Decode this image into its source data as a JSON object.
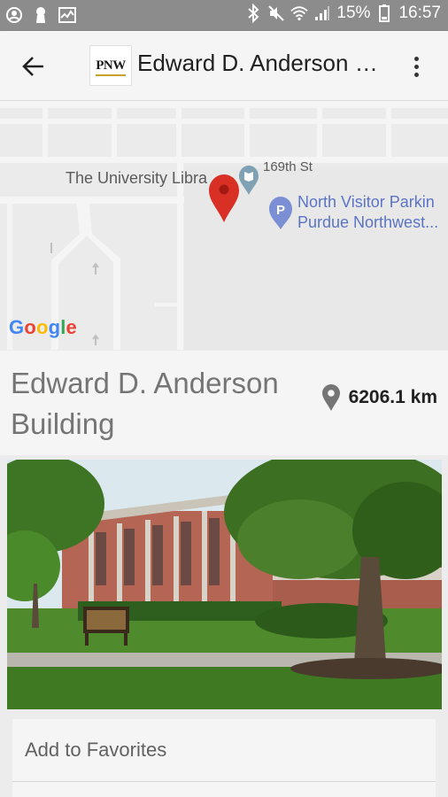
{
  "status_bar": {
    "battery": "15%",
    "time": "16:57",
    "left_icons": [
      "account-circle-icon",
      "keyhole-icon",
      "activity-chart-icon"
    ],
    "right_icons": [
      "bluetooth-icon",
      "mute-icon",
      "wifi-icon",
      "signal-icon",
      "battery-icon"
    ]
  },
  "app_bar": {
    "logo_text": "PNW",
    "title": "Edward D. Anderson Building",
    "back_icon": "arrow-back-icon",
    "menu_icon": "more-vert-icon"
  },
  "map": {
    "labels": {
      "library": "The University Libra",
      "street": "169th St",
      "parking_line1": "North Visitor Parkin",
      "parking_line2": "Purdue Northwest..."
    },
    "google_logo": "Google"
  },
  "building": {
    "name": "Edward D. Anderson Building",
    "distance": "6206.1 km"
  },
  "actions": {
    "add_to_favorites": "Add to Favorites"
  },
  "colors": {
    "status_bar": "#8c8c8c",
    "app_bar": "#f5f5f5",
    "pin": "#d93025",
    "poi": "#7b8fd4",
    "title_grey": "#757575"
  }
}
